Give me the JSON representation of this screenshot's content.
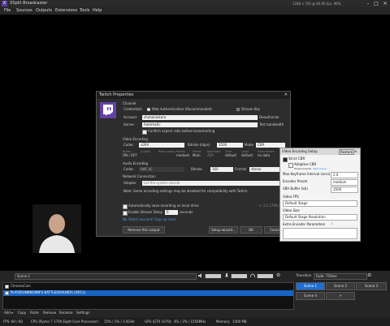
{
  "titlebar": {
    "title": "XSplit Broadcaster",
    "stats": "1280 x 720 @ 60.00 fps, 96%",
    "min": "–",
    "max": "□",
    "close": "✕"
  },
  "menu": [
    "File",
    "Sources",
    "Outputs",
    "Extensions",
    "Tools",
    "Help"
  ],
  "twitch": {
    "title": "Twitch Properties",
    "channel_section": "Channel",
    "credentials_label": "Credentials",
    "web_auth": "Web Authentication (Recommended)",
    "stream_key": "Stream Key",
    "account_label": "Account",
    "account_value": "shotukiestora",
    "deauthorize": "Deauthorize",
    "server_label": "Server",
    "server_value": "Automatic",
    "test_bandwidth": "Test bandwidth",
    "confirm_aspect": "Confirm aspect ratio before broadcasting",
    "video_section": "Video Encoding",
    "codec_label": "Codec",
    "codec_value": "x264",
    "bitrate_label": "Bitrate (kbps)",
    "bitrate_value": "3500",
    "mode_label": "Mode",
    "mode_value": "CBR",
    "col_headers": [
      "Buffer",
      "Quality",
      "Rate control",
      "Profile",
      "Preset",
      "Keyframe",
      "Tune",
      "Level",
      "Extra Param"
    ],
    "col_values": [
      "ON / OFF",
      "",
      "",
      "medium",
      "Main",
      "AVX",
      "default",
      "default",
      "no data"
    ],
    "audio_section": "Audio Encoding",
    "audio_codec_value": "AAC LC",
    "audio_bitrate_label": "Bitrate",
    "audio_bitrate_value": "160",
    "audio_format_label": "Format",
    "audio_format_value": "stereo",
    "network_section": "Network Connection",
    "adapter_label": "Adapter",
    "adapter_value": "Let the system decide",
    "note": "Note: Some encoding settings may be disabled for compatibility with Twitch.",
    "auto_save": "Automatically save recording on local drive",
    "version": "v. 3.1.1709.2301",
    "enable_delay": "Enable Stream Delay",
    "delay_value": "0",
    "delay_unit": "seconds",
    "no_account": "No Twitch account? Sign up here.",
    "remove_output": "Remove this output",
    "setup_wizard": "Setup wizard...",
    "ok": "OK",
    "cancel": "Cancel"
  },
  "video_encoding": {
    "title": "Video Encoding Setup",
    "restore": "Restore",
    "close": "✕",
    "strict_cbr": "Strict CBR",
    "adaptive_cbr": "Adaptive CBR",
    "adaptive_note": "(Experimental",
    "adaptive_link": "learn more...",
    "max_keyframe_label": "Max Keyframe Interval (secs)",
    "max_keyframe_value": "2.0",
    "preset_label": "Encoder Preset",
    "preset_value": "medium",
    "vbv_label": "VBV Buffer (kb)",
    "vbv_value": "3500",
    "fps_label": "Video FPS",
    "fps_value": "Default Stage",
    "size_label": "Video Size",
    "size_value": "Default Stage Resolution",
    "extra_label": "Extra Encoder Parameters",
    "extra_help": "?"
  },
  "scene_bar": {
    "scene_name": "Scene 1",
    "transition_label": "Transition",
    "transition_value": "Fade: 750ms",
    "scenes": [
      "Scene 1",
      "Scene 2",
      "Scene 3",
      "Scene 4",
      "+"
    ]
  },
  "sources": [
    {
      "name": "ChromaCam",
      "selected": false
    },
    {
      "name": "PLAYERUNKNOWN'S BATTLEGROUNDS (DX11)",
      "selected": true
    }
  ],
  "source_toolbar": [
    "Add ▾",
    "Copy",
    "Paste",
    "Remove",
    "Rename",
    "Settings"
  ],
  "status": {
    "fps": "FPS: 60 / 60",
    "cpu": "CPU (Ryzen 7 1700 Eight-Core Processor):",
    "cpu_value": "15% / 1% / 3.0GHz",
    "gpu": "GPU (GTX 1070):",
    "gpu_value": "4% / 2% / 1556MHz",
    "memory": "Memory:",
    "memory_value": "1400 MB"
  },
  "colors": {
    "accent": "#1d6fd6",
    "selection": "#1764c4",
    "bg": "#1b1b1b"
  }
}
